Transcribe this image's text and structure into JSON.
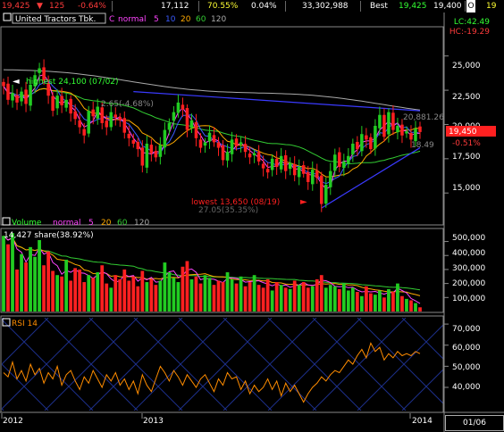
{
  "topbar": {
    "price": "19,425",
    "change_arrow": "▼",
    "change": "125",
    "change_pct": "-0.64%",
    "volume": "17,112",
    "ratio": "70.55%",
    "turnover_pct": "0.04%",
    "value": "33,302,988",
    "best_label": "Best",
    "best_bid": "19,425",
    "best_ask": "19,400",
    "open_label": "O",
    "open_value": "19"
  },
  "price_panel": {
    "ticker": "United Tractors Tbk.",
    "legend_c": "C",
    "legend_normal": "normal",
    "legend_ma": [
      "5",
      "10",
      "20",
      "60",
      "120"
    ],
    "lc_label": "LC:42.49",
    "hc_label": "HC:-19.29",
    "highest_label": "highest 24,100 (07/02)",
    "lowest_label": "lowest 13,650 (08/19)",
    "annot_pct_high": "2.65(-4.68%)",
    "annot_pct_low": "27.05(35.35%)",
    "annot_right": "20,881.26",
    "last_price": "19,450",
    "last_change": "-0.51%",
    "annot_1849": "18.49",
    "y_ticks": [
      "25,000",
      "22,500",
      "20,000",
      "17,500",
      "15,000"
    ]
  },
  "volume_panel": {
    "title": "Volume",
    "legend_normal": "normal",
    "legend_ma": [
      "5",
      "20",
      "60",
      "120"
    ],
    "share_label": "14,427 share(38.92%)",
    "y_ticks": [
      "500,000",
      "400,000",
      "300,000",
      "200,000",
      "100,000"
    ]
  },
  "rsi_panel": {
    "title": "RSI 14",
    "y_ticks": [
      "70,000",
      "60,000",
      "50,000",
      "40,000"
    ]
  },
  "x_labels": [
    "2012",
    "2013",
    "2014"
  ],
  "date_readout": "01/06",
  "colors": {
    "up": "#22cc22",
    "down": "#ff2020",
    "ma5": "#ff44ff",
    "ma10": "#3b5bff",
    "ma20": "#ffaa00",
    "ma60": "#33cc33",
    "ma120": "#aaaaaa",
    "rsi": "#ff8c00",
    "trendline": "#3a3aff"
  },
  "chart_data": [
    {
      "type": "candlestick",
      "title": "United Tractors Tbk.",
      "y_axis_ticks": [
        15000,
        17500,
        20000,
        22500,
        25000
      ],
      "ylim": [
        12800,
        27000
      ],
      "annotations": [
        "highest 24,100 (07/02)",
        "lowest 13,650 (08/19)"
      ],
      "closes": [
        22800,
        21800,
        22300,
        21600,
        22400,
        21500,
        22900,
        23600,
        24100,
        23200,
        22100,
        21000,
        22100,
        21400,
        21800,
        20800,
        20400,
        19800,
        19200,
        21000,
        20600,
        21300,
        20100,
        19800,
        20900,
        20500,
        20300,
        19400,
        19000,
        18600,
        18200,
        17000,
        18600,
        17900,
        17600,
        18500,
        19600,
        20100,
        20900,
        21600,
        21100,
        19600,
        20300,
        19000,
        18300,
        18700,
        19400,
        18700,
        18300,
        17400,
        18000,
        18900,
        18400,
        18700,
        18000,
        17600,
        17900,
        17300,
        16800,
        16500,
        17500,
        16900,
        17700,
        16600,
        17200,
        16300,
        16900,
        16400,
        15800,
        16700,
        16100,
        14200,
        15600,
        16600,
        17800,
        16900,
        17300,
        17700,
        18600,
        18200,
        19300,
        18900,
        18200,
        19900,
        20700,
        19100,
        20900,
        19600,
        19900,
        19200,
        19500,
        18900,
        19700,
        19450
      ]
    },
    {
      "type": "bar",
      "title": "Volume",
      "y_axis_ticks": [
        100000,
        200000,
        300000,
        400000,
        500000
      ],
      "ylim": [
        0,
        580000
      ],
      "values": [
        540000,
        480000,
        560000,
        300000,
        410000,
        350000,
        460000,
        390000,
        510000,
        330000,
        430000,
        290000,
        260000,
        250000,
        370000,
        220000,
        310000,
        300000,
        210000,
        260000,
        240000,
        280000,
        330000,
        200000,
        170000,
        260000,
        230000,
        300000,
        220000,
        250000,
        180000,
        290000,
        210000,
        230000,
        190000,
        220000,
        350000,
        280000,
        240000,
        210000,
        320000,
        360000,
        230000,
        250000,
        200000,
        260000,
        240000,
        190000,
        220000,
        210000,
        280000,
        230000,
        200000,
        250000,
        180000,
        210000,
        260000,
        190000,
        170000,
        230000,
        150000,
        210000,
        190000,
        170000,
        160000,
        220000,
        190000,
        210000,
        170000,
        180000,
        230000,
        260000,
        170000,
        190000,
        180000,
        160000,
        200000,
        150000,
        170000,
        140000,
        110000,
        180000,
        130000,
        120000,
        150000,
        100000,
        160000,
        140000,
        200000,
        110000,
        90000,
        80000,
        60000,
        30000
      ]
    },
    {
      "type": "line",
      "title": "RSI 14",
      "y_axis_ticks": [
        40000,
        50000,
        60000,
        70000
      ],
      "ylim": [
        29000,
        73000
      ],
      "values": [
        47000,
        45000,
        52000,
        44000,
        48000,
        43000,
        51000,
        46000,
        49000,
        42000,
        47000,
        44000,
        50000,
        41000,
        46000,
        48000,
        43000,
        39000,
        45000,
        42000,
        48000,
        44000,
        40000,
        46000,
        43000,
        47000,
        41000,
        44000,
        39000,
        43000,
        37000,
        46000,
        41000,
        38000,
        44000,
        50000,
        47000,
        43000,
        48000,
        45000,
        41000,
        46000,
        43000,
        40000,
        44000,
        46000,
        42000,
        38000,
        44000,
        41000,
        47000,
        44000,
        45000,
        39000,
        43000,
        37000,
        41000,
        38000,
        40000,
        44000,
        39000,
        43000,
        36000,
        42000,
        38000,
        41000,
        37000,
        33000,
        37000,
        40000,
        42000,
        45000,
        43000,
        46000,
        48000,
        47000,
        50000,
        53000,
        51000,
        55000,
        58000,
        54000,
        61000,
        57000,
        59000,
        53000,
        56000,
        54000,
        57000,
        55000,
        56000,
        55000,
        57000,
        56000
      ]
    }
  ]
}
